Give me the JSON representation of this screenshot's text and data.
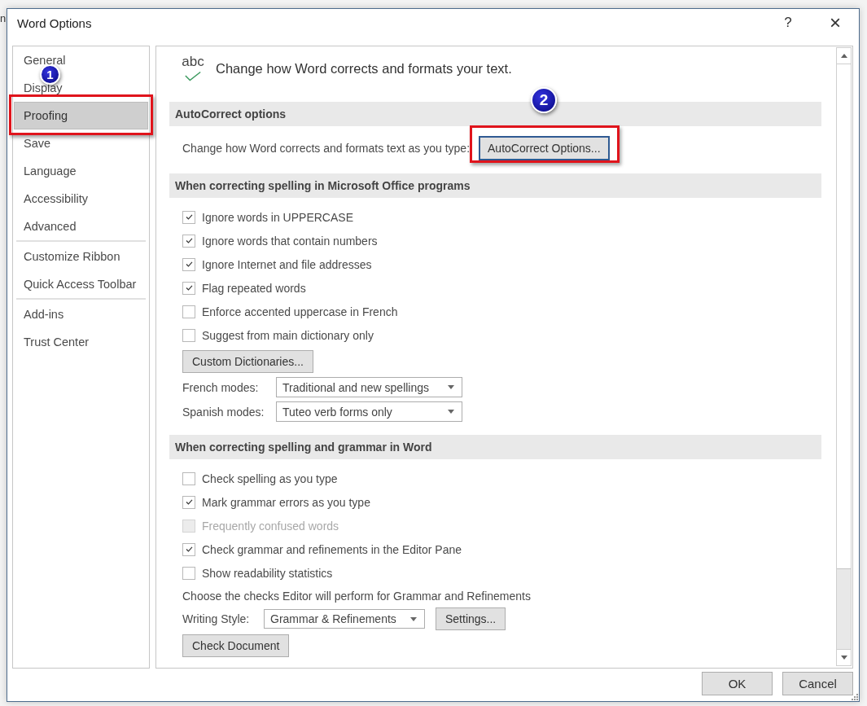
{
  "background_app": {
    "text_fragment": "n"
  },
  "window": {
    "title": "Word Options",
    "help_button": "?",
    "close_button": "×"
  },
  "sidebar": {
    "groups": [
      {
        "items": [
          {
            "label": "General",
            "selected": false,
            "highlighted": false
          },
          {
            "label": "Display",
            "selected": false,
            "highlighted": false
          },
          {
            "label": "Proofing",
            "selected": true,
            "highlighted": true,
            "badge": "1"
          },
          {
            "label": "Save",
            "selected": false,
            "highlighted": false
          },
          {
            "label": "Language",
            "selected": false,
            "highlighted": false
          },
          {
            "label": "Accessibility",
            "selected": false,
            "highlighted": false
          },
          {
            "label": "Advanced",
            "selected": false,
            "highlighted": false
          }
        ]
      },
      {
        "items": [
          {
            "label": "Customize Ribbon",
            "selected": false,
            "highlighted": false
          },
          {
            "label": "Quick Access Toolbar",
            "selected": false,
            "highlighted": false
          }
        ]
      },
      {
        "items": [
          {
            "label": "Add-ins",
            "selected": false,
            "highlighted": false
          },
          {
            "label": "Trust Center",
            "selected": false,
            "highlighted": false
          }
        ]
      }
    ]
  },
  "content": {
    "header": {
      "icon_text": "abc",
      "text": "Change how Word corrects and formats your text."
    },
    "sections": [
      {
        "title": "AutoCorrect options",
        "rows": [
          {
            "kind": "label_button",
            "label": "Change how Word corrects and formats text as you type:",
            "button": "AutoCorrect Options...",
            "focused": true,
            "highlighted": true,
            "badge": "2"
          }
        ]
      },
      {
        "title": "When correcting spelling in Microsoft Office programs",
        "rows": [
          {
            "kind": "checkbox",
            "label": "Ignore words in UPPERCASE",
            "checked": true,
            "disabled": false
          },
          {
            "kind": "checkbox",
            "label": "Ignore words that contain numbers",
            "checked": true,
            "disabled": false
          },
          {
            "kind": "checkbox",
            "label": "Ignore Internet and file addresses",
            "checked": true,
            "disabled": false
          },
          {
            "kind": "checkbox",
            "label": "Flag repeated words",
            "checked": true,
            "disabled": false
          },
          {
            "kind": "checkbox",
            "label": "Enforce accented uppercase in French",
            "checked": false,
            "disabled": false
          },
          {
            "kind": "checkbox",
            "label": "Suggest from main dictionary only",
            "checked": false,
            "disabled": false
          },
          {
            "kind": "button",
            "button": "Custom Dictionaries..."
          },
          {
            "kind": "dropdown",
            "label": "French modes:",
            "value": "Traditional and new spellings"
          },
          {
            "kind": "dropdown",
            "label": "Spanish modes:",
            "value": "Tuteo verb forms only"
          }
        ]
      },
      {
        "title": "When correcting spelling and grammar in Word",
        "rows": [
          {
            "kind": "checkbox",
            "label": "Check spelling as you type",
            "checked": false,
            "disabled": false
          },
          {
            "kind": "checkbox",
            "label": "Mark grammar errors as you type",
            "checked": true,
            "disabled": false
          },
          {
            "kind": "checkbox",
            "label": "Frequently confused words",
            "checked": false,
            "disabled": true
          },
          {
            "kind": "checkbox",
            "label": "Check grammar and refinements in the Editor Pane",
            "checked": true,
            "disabled": false
          },
          {
            "kind": "checkbox",
            "label": "Show readability statistics",
            "checked": false,
            "disabled": false
          },
          {
            "kind": "text",
            "text": "Choose the checks Editor will perform for Grammar and Refinements"
          },
          {
            "kind": "dropdown_button",
            "label": "Writing Style:",
            "value": "Grammar & Refinements",
            "button": "Settings..."
          },
          {
            "kind": "button",
            "button": "Check Document"
          }
        ]
      }
    ]
  },
  "footer_buttons": [
    "OK",
    "Cancel"
  ]
}
